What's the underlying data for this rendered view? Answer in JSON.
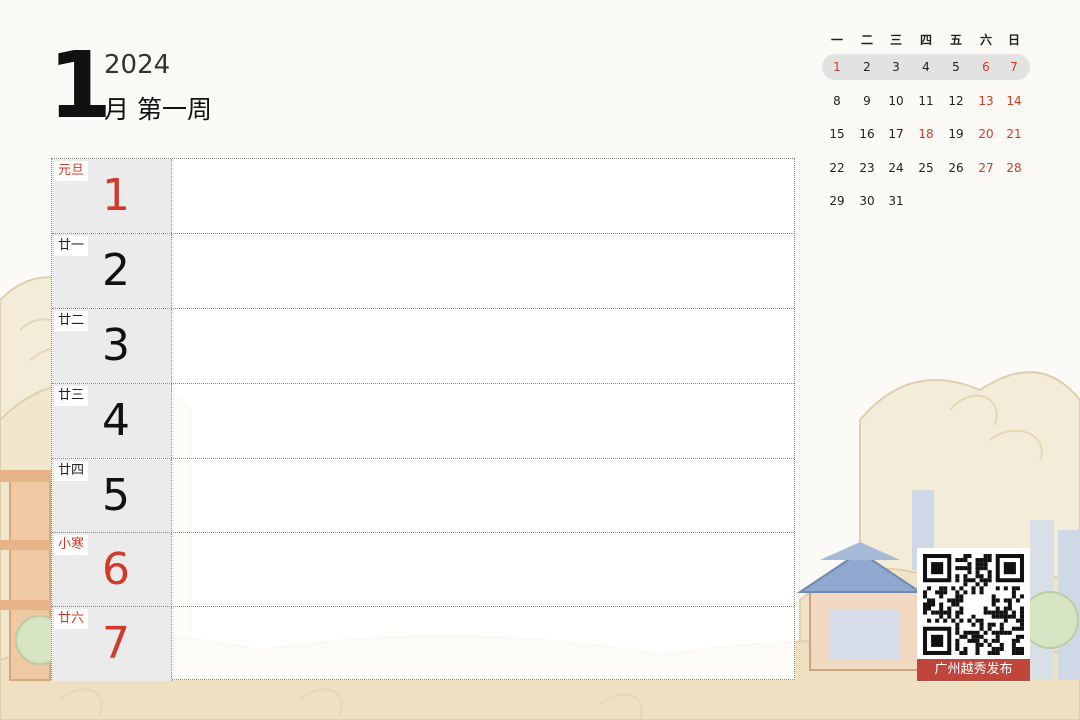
{
  "header": {
    "month": "1",
    "year": "2024",
    "week_title": "月 第一周"
  },
  "days": [
    {
      "lunar": "元旦",
      "day": "1",
      "red": true,
      "lunar_red": true
    },
    {
      "lunar": "廿一",
      "day": "2",
      "red": false,
      "lunar_red": false
    },
    {
      "lunar": "廿二",
      "day": "3",
      "red": false,
      "lunar_red": false
    },
    {
      "lunar": "廿三",
      "day": "4",
      "red": false,
      "lunar_red": false
    },
    {
      "lunar": "廿四",
      "day": "5",
      "red": false,
      "lunar_red": false
    },
    {
      "lunar": "小寒",
      "day": "6",
      "red": true,
      "lunar_red": true
    },
    {
      "lunar": "廿六",
      "day": "7",
      "red": true,
      "lunar_red": true
    }
  ],
  "mini_calendar": {
    "weekdays": [
      "一",
      "二",
      "三",
      "四",
      "五",
      "六",
      "日"
    ],
    "weeks": [
      [
        "1",
        "2",
        "3",
        "4",
        "5",
        "6",
        "7"
      ],
      [
        "8",
        "9",
        "10",
        "11",
        "12",
        "13",
        "14"
      ],
      [
        "15",
        "16",
        "17",
        "18",
        "19",
        "20",
        "21"
      ],
      [
        "22",
        "23",
        "24",
        "25",
        "26",
        "27",
        "28"
      ],
      [
        "29",
        "30",
        "31",
        "",
        "",
        "",
        ""
      ]
    ],
    "red_days": [
      "1",
      "6",
      "7",
      "13",
      "14",
      "18",
      "20",
      "21",
      "27",
      "28"
    ],
    "highlight_week": 1
  },
  "qr": {
    "label": "广州越秀发布"
  },
  "colors": {
    "accent_red": "#d03a2a",
    "date_col_bg": "#ebebeb",
    "qr_label_bg": "#c0463c"
  }
}
